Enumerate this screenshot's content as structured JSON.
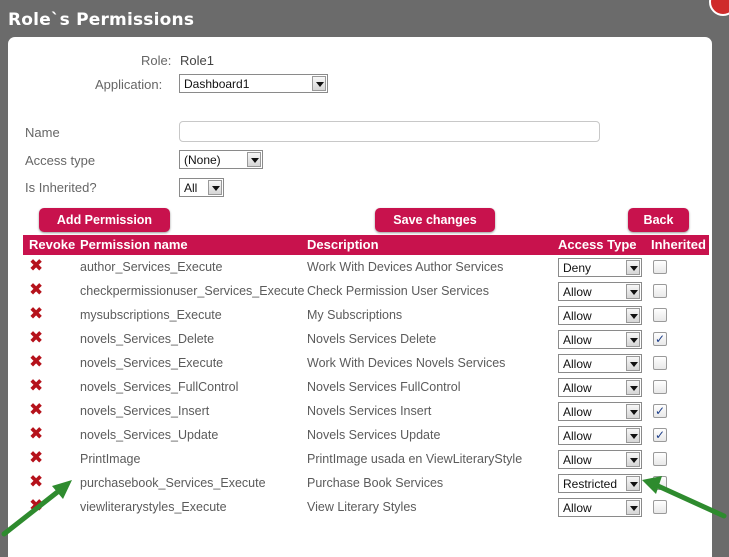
{
  "window": {
    "title": "Role`s Permissions"
  },
  "form": {
    "role_label": "Role:",
    "role_value": "Role1",
    "application_label": "Application:",
    "application_value": "Dashboard1",
    "name_label": "Name",
    "name_value": "",
    "access_type_label": "Access type",
    "access_type_value": "(None)",
    "is_inherited_label": "Is Inherited?",
    "is_inherited_value": "All"
  },
  "buttons": {
    "add_permission": "Add Permission",
    "save_changes": "Save changes",
    "back": "Back"
  },
  "table": {
    "headers": {
      "revoke": "Revoke",
      "permission_name": "Permission name",
      "description": "Description",
      "access_type": "Access Type",
      "inherited": "Inherited"
    },
    "rows": [
      {
        "name": "author_Services_Execute",
        "description": "Work With Devices Author Services",
        "access": "Deny",
        "inherited": false
      },
      {
        "name": "checkpermissionuser_Services_Execute",
        "description": "Check Permission User Services",
        "access": "Allow",
        "inherited": false
      },
      {
        "name": "mysubscriptions_Execute",
        "description": "My Subscriptions",
        "access": "Allow",
        "inherited": false
      },
      {
        "name": "novels_Services_Delete",
        "description": "Novels Services Delete",
        "access": "Allow",
        "inherited": true
      },
      {
        "name": "novels_Services_Execute",
        "description": "Work With Devices Novels Services",
        "access": "Allow",
        "inherited": false
      },
      {
        "name": "novels_Services_FullControl",
        "description": "Novels Services FullControl",
        "access": "Allow",
        "inherited": false
      },
      {
        "name": "novels_Services_Insert",
        "description": "Novels Services Insert",
        "access": "Allow",
        "inherited": true
      },
      {
        "name": "novels_Services_Update",
        "description": "Novels Services Update",
        "access": "Allow",
        "inherited": true
      },
      {
        "name": "PrintImage",
        "description": "PrintImage usada en ViewLiteraryStyle",
        "access": "Allow",
        "inherited": false
      },
      {
        "name": "purchasebook_Services_Execute",
        "description": "Purchase Book Services",
        "access": "Restricted",
        "inherited": false
      },
      {
        "name": "viewliterarystyles_Execute",
        "description": "View Literary Styles",
        "access": "Allow",
        "inherited": false
      }
    ]
  },
  "icons": {
    "revoke": "revoke-x-icon",
    "dropdown": "chevron-down-icon",
    "annotation": "green-arrow-icon"
  },
  "colors": {
    "accent": "#c8124d",
    "revoke": "#b5121b",
    "annotation": "#2e8b2e",
    "overlay": "#6b6b6b"
  }
}
